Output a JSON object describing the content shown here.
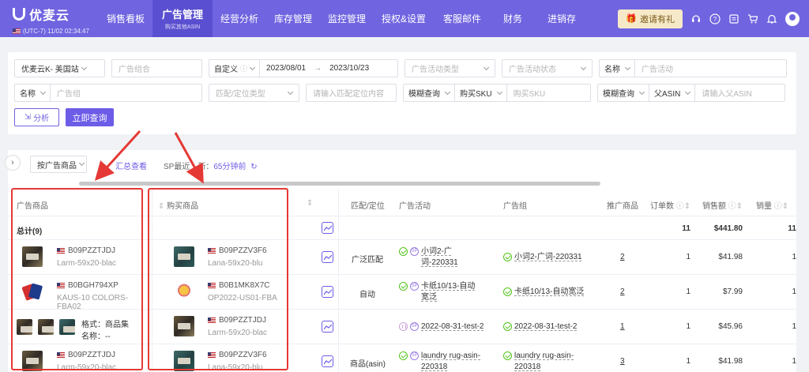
{
  "brand": {
    "name": "优麦云",
    "time": "(UTC-7) 11/02 02:34:47"
  },
  "nav": [
    {
      "label": "销售看板"
    },
    {
      "label": "广告管理",
      "sub": "购买其他ASIN",
      "active": true
    },
    {
      "label": "经营分析"
    },
    {
      "label": "库存管理"
    },
    {
      "label": "监控管理"
    },
    {
      "label": "授权&设置"
    },
    {
      "label": "客服邮件"
    },
    {
      "label": "财务"
    },
    {
      "label": "进销存"
    }
  ],
  "top_right": {
    "invite_label": "邀请有礼"
  },
  "filters": {
    "row1": {
      "store": "优麦云K- 美国站",
      "ad_combo_ph": "广告组合",
      "date_mode": "自定义",
      "date_start": "2023/08/01",
      "date_sep": "→",
      "date_end": "2023/10/23",
      "campaign_type_ph": "广告活动类型",
      "campaign_status_ph": "广告活动状态",
      "name_sel": "名称",
      "campaign_ph": "广告活动"
    },
    "row2": {
      "name_sel": "名称",
      "group_ph": "广告组",
      "match_type_ph": "匹配/定位类型",
      "match_input_ph": "请输入匹配定位内容",
      "fuzzy1": "模糊查询",
      "sku_sel": "购买SKU",
      "sku_ph": "购买SKU",
      "fuzzy2": "模糊查询",
      "asin_sel": "父ASIN",
      "asin_ph": "请输入父ASIN"
    },
    "analyze_label": "分析",
    "query_label": "立即查询"
  },
  "toolbar": {
    "group_by": "按广告商品",
    "summary_link": "汇总查看",
    "sp_prefix": "SP最近",
    "sp_suffix": "新：",
    "sp_value": "65分钟前"
  },
  "columns": {
    "ad_product": "广告商品",
    "buy_product": "购买商品",
    "match": "匹配/定位",
    "campaign": "广告活动",
    "ad_group": "广告组",
    "promoted": "推广商品",
    "orders": "订单数",
    "sales": "销售额",
    "units": "销量"
  },
  "total": {
    "label": "总计(9)",
    "orders": "11",
    "sales": "$441.80",
    "units": "11"
  },
  "rows": [
    {
      "ad_asin": "B09PZZTJDJ",
      "ad_sku": "Larm-59x20-blac",
      "buy_asin": "B09PZZV3F6",
      "buy_sku": "Lana-59x20-blu",
      "match": "广泛匹配",
      "campaign": "小词2-广词-220331",
      "ad_group": "小词2-广词-220331",
      "promoted": "2",
      "orders": "1",
      "sales": "$41.98",
      "units": "1"
    },
    {
      "ad_asin": "B0BGH794XP",
      "ad_sku": "KAUS-10 COLORS-FBA02",
      "buy_asin": "B0B1MK8X7C",
      "buy_sku": "OP2022-US01-FBA",
      "match": "自动",
      "campaign": "卡纸10/13-自动宽泛",
      "ad_group": "卡纸10/13-自动宽泛",
      "promoted": "2",
      "orders": "1",
      "sales": "$7.99",
      "units": "1"
    },
    {
      "ad_format_label": "格式：商品集",
      "ad_name_label": "名称：--",
      "buy_asin": "B09PZZTJDJ",
      "buy_sku": "Larm-59x20-blac",
      "match": "",
      "campaign": "2022-08-31-test-2",
      "ad_group": "2022-08-31-test-2",
      "promoted": "1",
      "orders": "1",
      "sales": "$45.96",
      "units": "1"
    },
    {
      "ad_asin": "B09PZZTJDJ",
      "ad_sku": "Larm-59x20-blac",
      "buy_asin": "B09PZZV3F6",
      "buy_sku": "Lana-59x20-blu",
      "match": "商品(asin)",
      "campaign": "laundry rug-asin-220318",
      "ad_group": "laundry rug-asin-220318",
      "promoted": "3",
      "orders": "1",
      "sales": "$41.98",
      "units": "1"
    }
  ],
  "colors": {
    "brand": "#7064e0",
    "accent": "#6c5ce7",
    "annotation": "#e53935"
  }
}
